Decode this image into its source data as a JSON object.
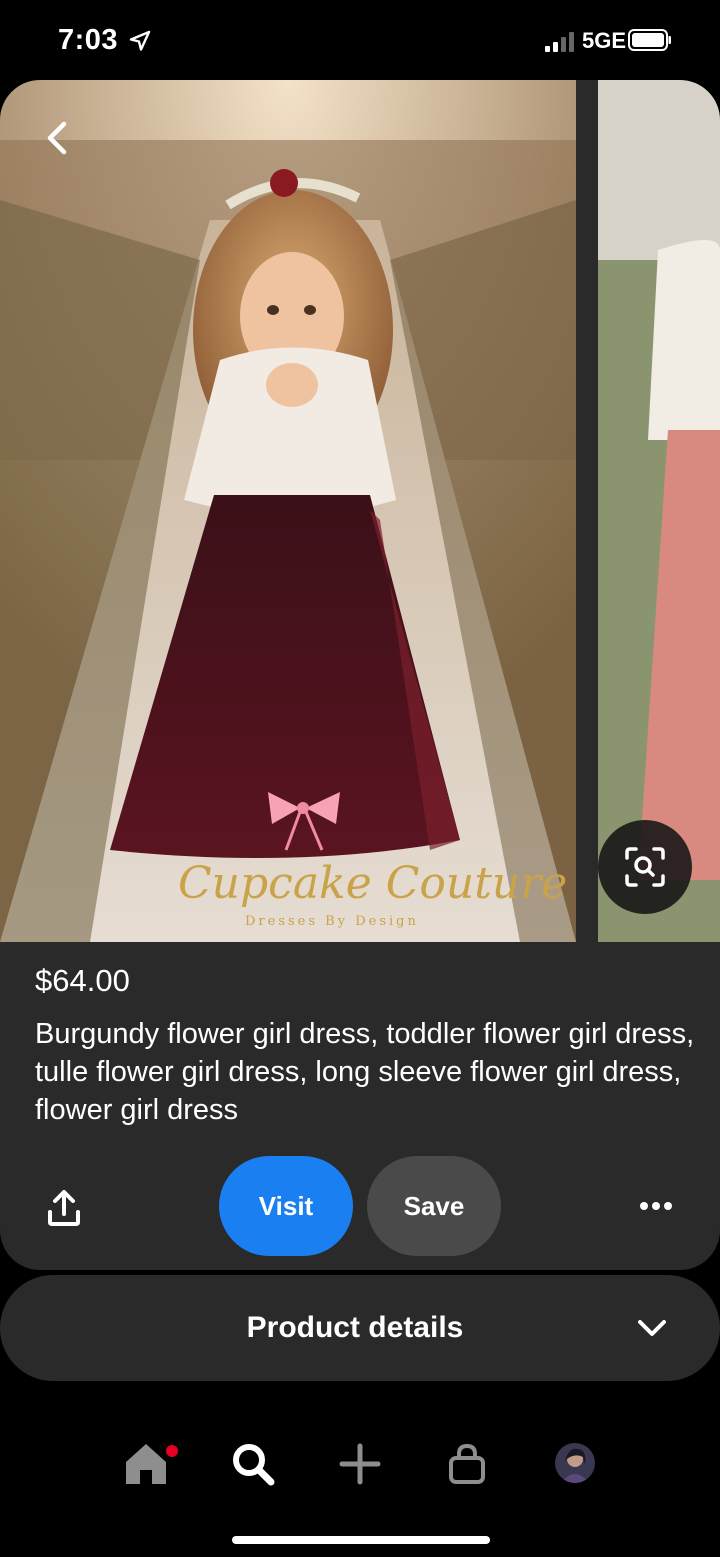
{
  "status_bar": {
    "time": "7:03",
    "network": "5GE"
  },
  "pin": {
    "price": "$64.00",
    "title": "Burgundy flower girl dress, toddler flower girl dress, tulle flower girl dress, long sleeve flower girl dress, flower girl dress",
    "watermark_text": "Cupcake Couture",
    "watermark_subtext": "Dresses By Design"
  },
  "actions": {
    "visit_label": "Visit",
    "save_label": "Save"
  },
  "details": {
    "label": "Product details"
  },
  "colors": {
    "visit": "#1a7ff0",
    "save": "#4a4a4a",
    "card": "#2a2a2a",
    "notification_dot": "#e60023"
  },
  "icons": [
    "location-arrow-icon",
    "signal-icon",
    "battery-icon",
    "back-chevron-icon",
    "visual-search-icon",
    "share-icon",
    "more-icon",
    "chevron-down-icon",
    "home-icon",
    "search-icon",
    "plus-icon",
    "shop-bag-icon"
  ]
}
